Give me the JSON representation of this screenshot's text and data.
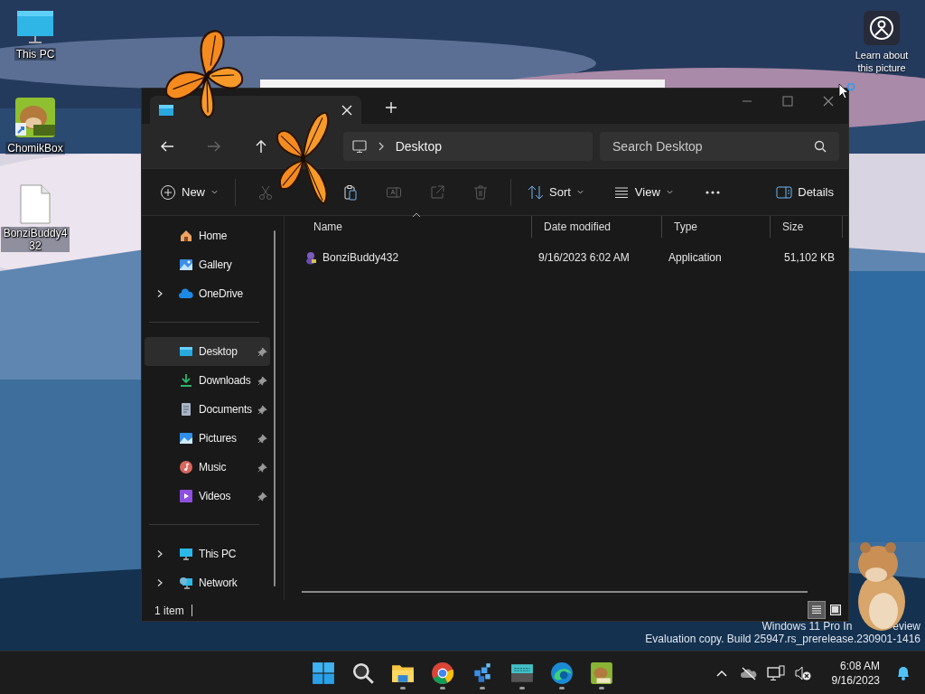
{
  "desktop_icons": [
    {
      "label": "This PC"
    },
    {
      "label": "ChomikBox"
    },
    {
      "label": "BonziBuddy432"
    }
  ],
  "spotlight": {
    "label": "Learn about this picture"
  },
  "explorer": {
    "address": {
      "crumb": "Desktop"
    },
    "search": {
      "placeholder": "Search Desktop"
    },
    "toolbar": {
      "new_label": "New",
      "actions": [
        {
          "kind": "cut",
          "disabled": true
        },
        {
          "kind": "paste",
          "disabled": false
        },
        {
          "kind": "rename",
          "disabled": true
        },
        {
          "kind": "share",
          "disabled": true
        },
        {
          "kind": "delete",
          "disabled": true
        }
      ],
      "sort_label": "Sort",
      "view_label": "View",
      "details_label": "Details"
    },
    "sidebar": {
      "groups": [
        [
          {
            "label": "Home",
            "expandable": false,
            "pinned": false,
            "selected": false
          },
          {
            "label": "Gallery",
            "expandable": false,
            "pinned": false,
            "selected": false
          },
          {
            "label": "OneDrive",
            "expandable": true,
            "pinned": false,
            "selected": false
          }
        ],
        [
          {
            "label": "Desktop",
            "expandable": false,
            "pinned": true,
            "selected": true
          },
          {
            "label": "Downloads",
            "expandable": false,
            "pinned": true,
            "selected": false
          },
          {
            "label": "Documents",
            "expandable": false,
            "pinned": true,
            "selected": false
          },
          {
            "label": "Pictures",
            "expandable": false,
            "pinned": true,
            "selected": false
          },
          {
            "label": "Music",
            "expandable": false,
            "pinned": true,
            "selected": false
          },
          {
            "label": "Videos",
            "expandable": false,
            "pinned": true,
            "selected": false
          }
        ],
        [
          {
            "label": "This PC",
            "expandable": true,
            "pinned": false,
            "selected": false
          },
          {
            "label": "Network",
            "expandable": true,
            "pinned": false,
            "selected": false
          }
        ]
      ]
    },
    "columns": [
      {
        "label": "Name",
        "sorted": true
      },
      {
        "label": "Date modified",
        "sorted": false
      },
      {
        "label": "Type",
        "sorted": false
      },
      {
        "label": "Size",
        "sorted": false
      }
    ],
    "rows": [
      {
        "name": "BonziBuddy432",
        "date_modified": "9/16/2023 6:02 AM",
        "type": "Application",
        "size": "51,102 KB"
      }
    ],
    "status": "1 item",
    "view_modes": [
      {
        "selected": true
      },
      {
        "selected": false
      }
    ]
  },
  "watermark": {
    "line_1_left": "Windows 11 Pro In",
    "line_1_right": "eview",
    "line_2": "Evaluation copy. Build 25947.rs_prerelease.230901-1416"
  },
  "taskbar": {
    "apps": [
      {
        "running": false
      },
      {
        "running": false
      },
      {
        "running": true
      },
      {
        "running": true
      },
      {
        "running": true
      },
      {
        "running": true
      },
      {
        "running": true
      },
      {
        "running": true
      }
    ],
    "time": "6:08 AM",
    "date": "9/16/2023"
  }
}
